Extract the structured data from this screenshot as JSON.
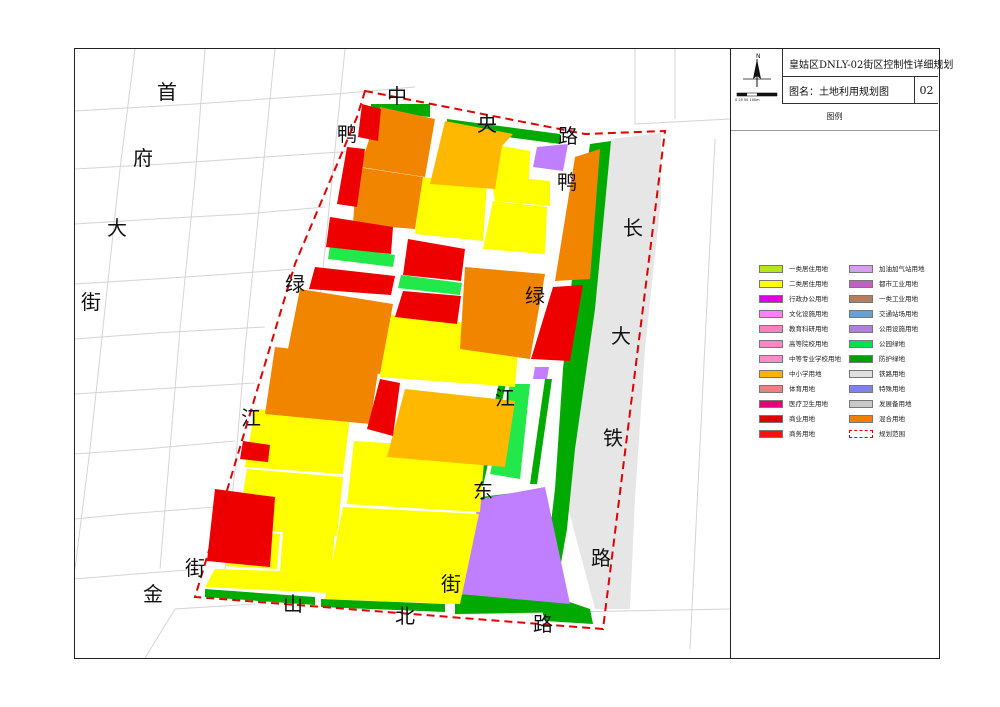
{
  "title_block": {
    "plan_title": "皇姑区DNLY-02街区控制性详细规划",
    "map_name": "图名：土地利用规划图",
    "map_number": "02",
    "legend_title": "图例",
    "north_mark": "N",
    "scale_text": "0  25  50     100m"
  },
  "road_labels": {
    "shoufu": [
      "首",
      "府",
      "大",
      "街"
    ],
    "zhongyang": [
      "中",
      "央",
      "路"
    ],
    "yalvjiang_w": [
      "鸭",
      "绿",
      "江",
      "街"
    ],
    "yalvjiang_e": [
      "鸭",
      "绿",
      "江",
      "东",
      "街"
    ],
    "changda": [
      "长",
      "大",
      "铁",
      "路"
    ],
    "jinshan": [
      "金",
      "山",
      "北",
      "路"
    ]
  },
  "legend": {
    "left": [
      {
        "label": "一类居住用地",
        "color": "#b5e61d"
      },
      {
        "label": "二类居住用地",
        "color": "#ffff00"
      },
      {
        "label": "行政办公用地",
        "color": "#e000e0"
      },
      {
        "label": "文化设施用地",
        "color": "#ff80ff"
      },
      {
        "label": "教育科研用地",
        "color": "#ff7fbf"
      },
      {
        "label": "高等院校用地",
        "color": "#ff86c0"
      },
      {
        "label": "中等专业学校用地",
        "color": "#ff8cc6"
      },
      {
        "label": "中小学用地",
        "color": "#ffb000"
      },
      {
        "label": "体育用地",
        "color": "#f08080"
      },
      {
        "label": "医疗卫生用地",
        "color": "#e8007a"
      },
      {
        "label": "商业用地",
        "color": "#e00000"
      },
      {
        "label": "商务用地",
        "color": "#ff1010"
      }
    ],
    "right": [
      {
        "label": "加油加气站用地",
        "color": "#d89cf0"
      },
      {
        "label": "都市工业用地",
        "color": "#c060c0"
      },
      {
        "label": "一类工业用地",
        "color": "#b08060"
      },
      {
        "label": "交通站场用地",
        "color": "#6aa0d0"
      },
      {
        "label": "公用设施用地",
        "color": "#b080e0"
      },
      {
        "label": "公园绿地",
        "color": "#00e050"
      },
      {
        "label": "防护绿地",
        "color": "#00a000"
      },
      {
        "label": "铁路用地",
        "color": "#e0e0e0"
      },
      {
        "label": "特殊用地",
        "color": "#8080f0"
      },
      {
        "label": "发展备用地",
        "color": "#c8c8c8"
      },
      {
        "label": "混合用地",
        "color": "#f08000"
      },
      {
        "label": "规划范围",
        "color": "#ffffff",
        "border": "#e00000"
      }
    ]
  },
  "colors": {
    "residential": "#ffff00",
    "school": "#ffb800",
    "commercial": "#ee0000",
    "mixed": "#f28500",
    "park": "#22e84a",
    "protective": "#00aa00",
    "utility": "#bf7fff",
    "railway": "#e6e6e6",
    "boundary": "#e00000"
  }
}
